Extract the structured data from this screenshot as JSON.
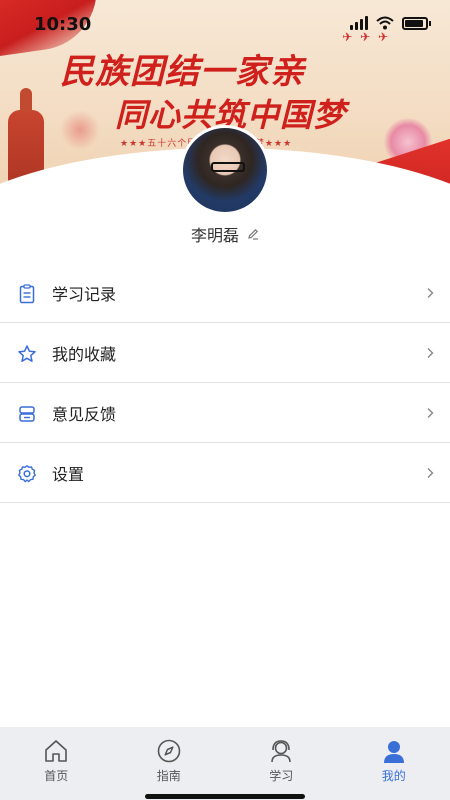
{
  "status": {
    "time": "10:30"
  },
  "banner": {
    "slogan_line1": "民族团结一家亲",
    "slogan_line2": "同心共筑中国梦",
    "subline": "★★★五十六个民族 ……… 国梦★★★"
  },
  "profile": {
    "username": "李明磊",
    "avatar_icon": "avatar-illustration"
  },
  "menu": {
    "items": [
      {
        "label": "学习记录",
        "icon": "clipboard-icon"
      },
      {
        "label": "我的收藏",
        "icon": "star-icon"
      },
      {
        "label": "意见反馈",
        "icon": "feedback-icon"
      },
      {
        "label": "设置",
        "icon": "gear-icon"
      }
    ]
  },
  "tabbar": {
    "active_index": 3,
    "active_color": "#3a6fd8",
    "tabs": [
      {
        "label": "首页",
        "icon": "home-icon"
      },
      {
        "label": "指南",
        "icon": "compass-icon"
      },
      {
        "label": "学习",
        "icon": "headset-icon"
      },
      {
        "label": "我的",
        "icon": "user-icon"
      }
    ]
  },
  "colors": {
    "accent": "#3a6fd8",
    "banner_red": "#d0201c",
    "divider": "#e1e3e8"
  }
}
